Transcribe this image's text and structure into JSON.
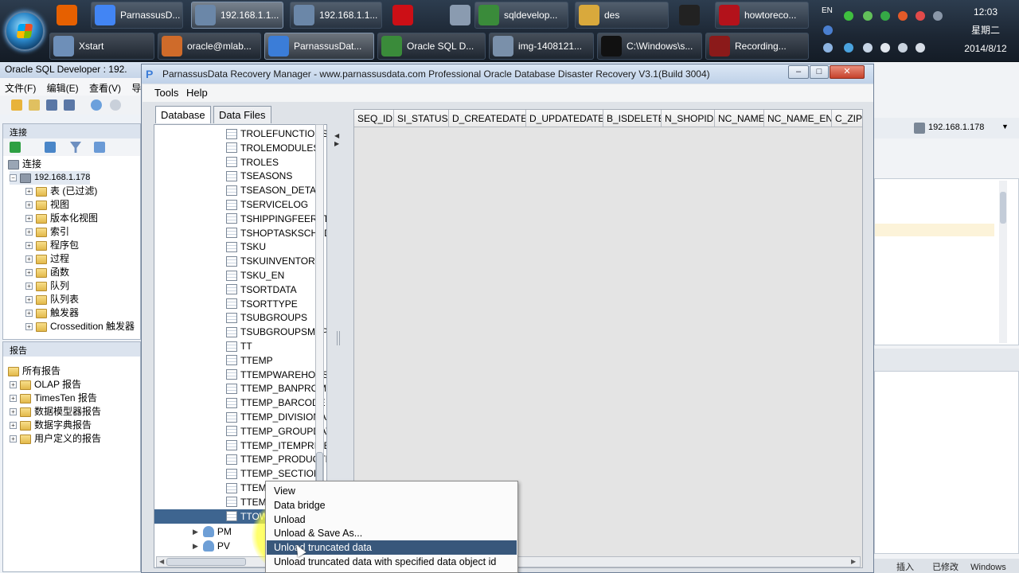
{
  "taskbar": {
    "row1": [
      {
        "label": "",
        "icon": "firefox-icon",
        "color": "#e66000"
      },
      {
        "label": "ParnassusD...",
        "icon": "chrome-icon",
        "color": "#4285f4"
      },
      {
        "label": "192.168.1.1...",
        "icon": "remote-desktop-icon",
        "color": "#6b87a8"
      },
      {
        "label": "192.168.1.1...",
        "icon": "remote-desktop-icon",
        "color": "#6b87a8"
      },
      {
        "label": "",
        "icon": "opera-icon",
        "color": "#cc0f16"
      },
      {
        "label": "",
        "icon": "tool-icon",
        "color": "#8a9bb0"
      },
      {
        "label": "sqldevelop...",
        "icon": "sqldeveloper-icon",
        "color": "#3a8b3a"
      },
      {
        "label": "des",
        "icon": "folder-icon",
        "color": "#d9a93c"
      },
      {
        "label": "",
        "icon": "qq-icon",
        "color": "#222222"
      },
      {
        "label": "howtoreco...",
        "icon": "pdf-icon",
        "color": "#b3121b"
      }
    ],
    "row2": [
      {
        "label": "Xstart",
        "icon": "xstart-icon",
        "color": "#6e8fb8"
      },
      {
        "label": "oracle@mlab...",
        "icon": "terminal-icon",
        "color": "#cf6b2a"
      },
      {
        "label": "ParnassusDat...",
        "icon": "parnassus-icon",
        "color": "#3b7dd8"
      },
      {
        "label": "Oracle SQL D...",
        "icon": "sqldeveloper-icon",
        "color": "#3a8b3a"
      },
      {
        "label": "img-1408121...",
        "icon": "image-viewer-icon",
        "color": "#7a90aa"
      },
      {
        "label": "C:\\Windows\\s...",
        "icon": "cmd-icon",
        "color": "#111111"
      },
      {
        "label": "Recording...",
        "icon": "recorder-icon",
        "color": "#8b1a1a"
      }
    ],
    "tray_lang": "EN",
    "clock": {
      "time": "12:03",
      "weekday": "星期二",
      "date": "2014/8/12"
    }
  },
  "sqldev": {
    "title": "Oracle SQL Developer : 192.",
    "menu": [
      "文件(F)",
      "编辑(E)",
      "查看(V)",
      "导航"
    ],
    "connections_label": "连接",
    "root_label": "连接",
    "connection_name": "192.168.1.178",
    "tree_items": [
      "表 (已过滤)",
      "视图",
      "版本化视图",
      "索引",
      "程序包",
      "过程",
      "函数",
      "队列",
      "队列表",
      "触发器",
      "Crossedition 触发器"
    ],
    "reports_label": "报告",
    "reports_root": "所有报告",
    "report_items": [
      "OLAP 报告",
      "TimesTen 报告",
      "数据模型器报告",
      "数据字典报告",
      "用户定义的报告"
    ],
    "right_conn": "192.168.1.178",
    "status_items": [
      "插入",
      "已修改",
      "Windows"
    ]
  },
  "window": {
    "title": "ParnassusData Recovery Manager - www.parnassusdata.com  Professional Oracle Database Disaster Recovery   V3.1(Build 3004)",
    "menu": [
      "Tools",
      "Help"
    ],
    "tabs": [
      "Database",
      "Data Files"
    ],
    "tables": [
      "TROLEFUNCTIONS",
      "TROLEMODULES",
      "TROLES",
      "TSEASONS",
      "TSEASON_DETAIL",
      "TSERVICELOG",
      "TSHIPPINGFEERATE",
      "TSHOPTASKSCHEDULE",
      "TSKU",
      "TSKUINVENTORY",
      "TSKU_EN",
      "TSORTDATA",
      "TSORTTYPE",
      "TSUBGROUPS",
      "TSUBGROUPSMAP",
      "TT",
      "TTEMP",
      "TTEMPWAREHOUSE",
      "TTEMP_BANPROMO",
      "TTEMP_BARCODE",
      "TTEMP_DIVISIONA",
      "TTEMP_GROUPDATA",
      "TTEMP_ITEMPRICE",
      "TTEMP_PRODUCTD",
      "TTEMP_SECTION",
      "TTEM",
      "TTEM",
      "TTOW"
    ],
    "schemas": [
      "PM",
      "PV"
    ],
    "columns": [
      "SEQ_ID",
      "SI_STATUS",
      "D_CREATEDATE",
      "D_UPDATEDATE",
      "B_ISDELETE",
      "N_SHOPID",
      "NC_NAME",
      "NC_NAME_EN",
      "C_ZIP"
    ]
  },
  "context_menu": {
    "items": [
      "View",
      "Data bridge",
      "Unload",
      "Unload & Save As...",
      "Unload truncated data",
      "Unload truncated data with specified data object id"
    ],
    "highlighted": "Unload truncated data"
  }
}
